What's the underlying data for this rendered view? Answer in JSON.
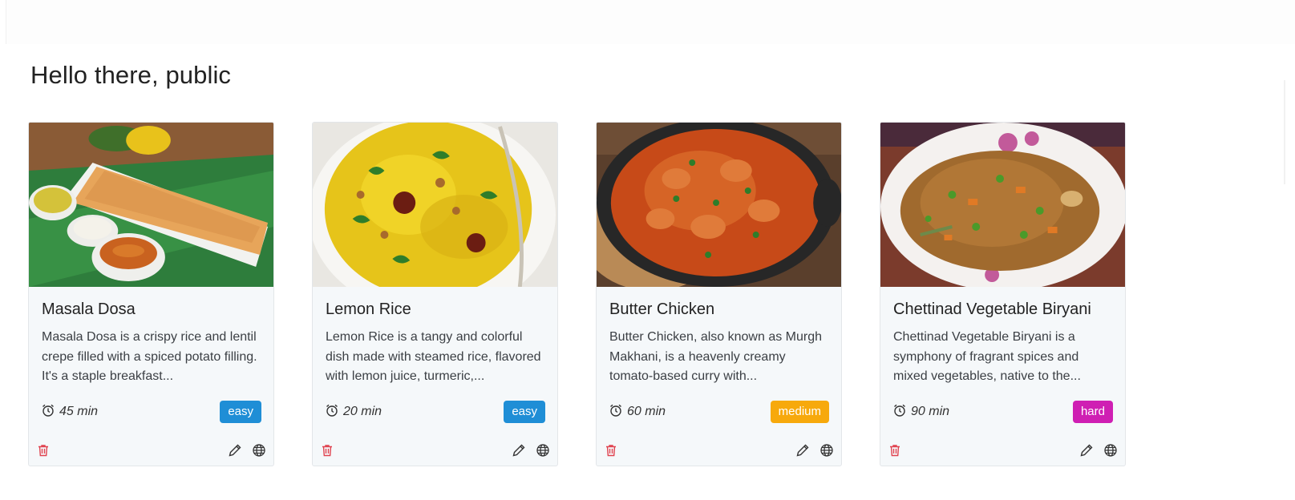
{
  "greeting": "Hello there, public",
  "recipes": [
    {
      "title": "Masala Dosa",
      "description": "Masala Dosa is a crispy rice and lentil crepe filled with a spiced potato filling. It's a staple breakfast...",
      "time": "45 min",
      "difficulty": "easy",
      "difficulty_color": "#1f8ed6",
      "image": "masala-dosa-photo"
    },
    {
      "title": "Lemon Rice",
      "description": "Lemon Rice is a tangy and colorful dish made with steamed rice, flavored with lemon juice, turmeric,...",
      "time": "20 min",
      "difficulty": "easy",
      "difficulty_color": "#1f8ed6",
      "image": "lemon-rice-photo"
    },
    {
      "title": "Butter Chicken",
      "description": "Butter Chicken, also known as Murgh Makhani, is a heavenly creamy tomato-based curry with...",
      "time": "60 min",
      "difficulty": "medium",
      "difficulty_color": "#f7a90c",
      "image": "butter-chicken-photo"
    },
    {
      "title": "Chettinad Vegetable Biryani",
      "description": "Chettinad Vegetable Biryani is a symphony of fragrant spices and mixed vegetables, native to the...",
      "time": "90 min",
      "difficulty": "hard",
      "difficulty_color": "#cf1fb3",
      "image": "vegetable-biryani-photo"
    }
  ],
  "icons": {
    "time": "alarm-clock-icon",
    "delete": "trash-icon",
    "edit": "pencil-icon",
    "publish": "globe-icon"
  },
  "colors": {
    "delete": "#e0434f",
    "card_bg": "#f5f8fa"
  }
}
